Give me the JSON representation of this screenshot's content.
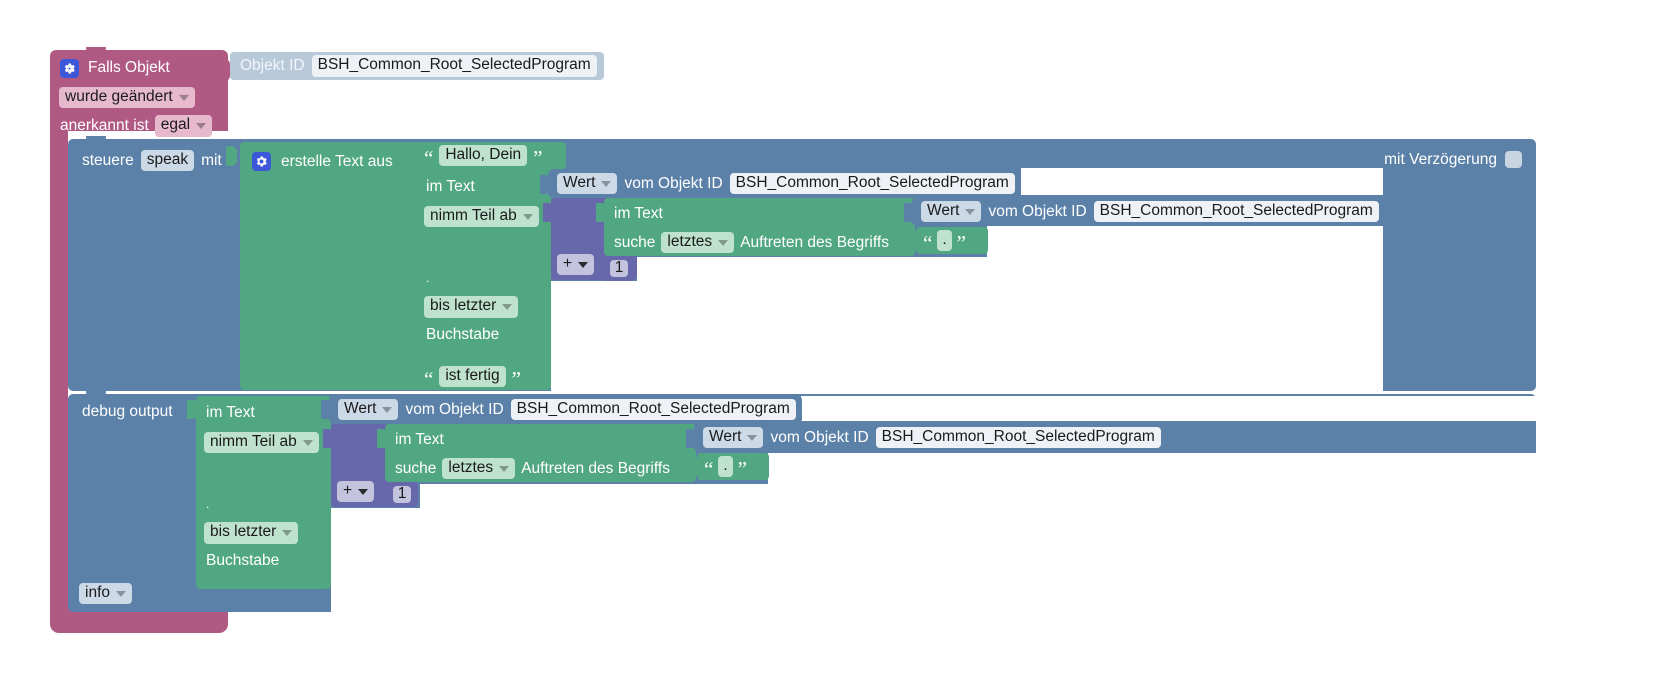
{
  "app": {
    "type": "blockly-visual-script-editor",
    "language": "de",
    "canvas_background": "#ffffff",
    "grid_color": "#d6d6d6"
  },
  "colors": {
    "trigger_pink": "#b05a83",
    "object_id_light_blue": "#b8c9da",
    "control_blue": "#5b81a8",
    "text_green": "#52a783",
    "math_purple": "#6668ab",
    "gear_icon_blue": "#3c58d8"
  },
  "blocks": {
    "trigger": {
      "name": "falls-objekt-trigger",
      "title": "Falls Objekt",
      "gear_icon": "gear-icon",
      "condition_dropdown": "wurde geändert",
      "ack_label": "anerkannt ist",
      "ack_dropdown": "egal",
      "object_id_block": {
        "label": "Objekt ID",
        "value": "BSH_Common_Root_SelectedProgram"
      }
    },
    "control": {
      "name": "steuere-speak-block",
      "prefix": "steuere",
      "target_chip": "speak",
      "suffix": "mit",
      "delay_label": "mit Verzögerung",
      "delay_checkbox_checked": false
    },
    "create_text": {
      "name": "erstelle-text-aus-block",
      "gear_icon": "gear-icon",
      "title": "erstelle Text aus",
      "items": [
        {
          "kind": "string",
          "value": "Hallo, Dein"
        },
        {
          "kind": "substring",
          "in_text_label": "im Text",
          "source": {
            "value_dropdown": "Wert",
            "from_label": "vom Objekt ID",
            "object_id": "BSH_Common_Root_SelectedProgram"
          },
          "take_dropdown": "nimm Teil ab",
          "from_index": {
            "operator": "+",
            "number": "1",
            "search_in_text_label": "im Text",
            "search_source": {
              "value_dropdown": "Wert",
              "from_label": "vom Objekt ID",
              "object_id": "BSH_Common_Root_SelectedProgram"
            },
            "search_label": "suche",
            "search_dropdown": "letztes",
            "search_suffix": "Auftreten des Begriffs",
            "search_term": "."
          },
          "to_label": ".",
          "to_dropdown": "bis letzter",
          "to_unit": "Buchstabe"
        },
        {
          "kind": "string",
          "value": "ist fertig"
        }
      ]
    },
    "debug": {
      "name": "debug-output-block",
      "title": "debug output",
      "level_dropdown": "info",
      "substring": {
        "in_text_label": "im Text",
        "source": {
          "value_dropdown": "Wert",
          "from_label": "vom Objekt ID",
          "object_id": "BSH_Common_Root_SelectedProgram"
        },
        "take_dropdown": "nimm Teil ab",
        "from_index": {
          "operator": "+",
          "number": "1",
          "search_in_text_label": "im Text",
          "search_source": {
            "value_dropdown": "Wert",
            "from_label": "vom Objekt ID",
            "object_id": "BSH_Common_Root_SelectedProgram"
          },
          "search_label": "suche",
          "search_dropdown": "letztes",
          "search_suffix": "Auftreten des Begriffs",
          "search_term": "."
        },
        "to_label": ".",
        "to_dropdown": "bis letzter",
        "to_unit": "Buchstabe"
      }
    }
  }
}
